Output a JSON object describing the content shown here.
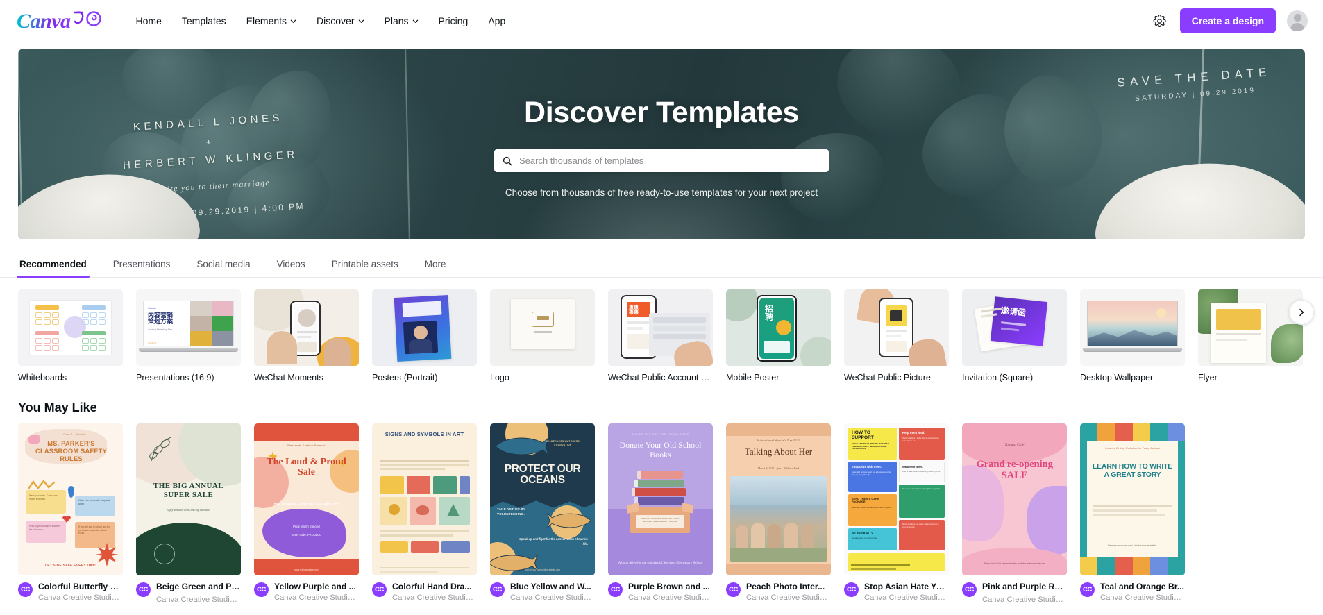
{
  "header": {
    "logo_text": "Canva",
    "nav": [
      {
        "label": "Home",
        "caret": false
      },
      {
        "label": "Templates",
        "caret": false
      },
      {
        "label": "Elements",
        "caret": true
      },
      {
        "label": "Discover",
        "caret": true
      },
      {
        "label": "Plans",
        "caret": true
      },
      {
        "label": "Pricing",
        "caret": false
      },
      {
        "label": "App",
        "caret": false
      }
    ],
    "settings_icon": "gear-icon",
    "cta_label": "Create a design",
    "accent_color": "#8b3dff"
  },
  "hero": {
    "title": "Discover Templates",
    "subtitle": "Choose from thousands of free ready-to-use templates for your next project",
    "search_placeholder": "Search thousands of templates",
    "search_value": "",
    "banner_art": {
      "name_1": "KENDALL L JONES",
      "plus": "+",
      "name_2": "HERBERT W KLINGER",
      "script_line": "invite you to their marriage",
      "date_line": "SATURDAY | 09.29.2019 | 4:00 PM",
      "save_the_date": "SAVE THE DATE",
      "save_the_date_sub": "SATURDAY | 09.29.2019"
    }
  },
  "tabs": [
    {
      "label": "Recommended",
      "active": true
    },
    {
      "label": "Presentations",
      "active": false
    },
    {
      "label": "Social media",
      "active": false
    },
    {
      "label": "Videos",
      "active": false
    },
    {
      "label": "Printable assets",
      "active": false
    },
    {
      "label": "More",
      "active": false
    }
  ],
  "categories": {
    "next_icon": "chevron-right-icon",
    "items": [
      {
        "label": "Whiteboards"
      },
      {
        "label": "Presentations (16:9)"
      },
      {
        "label": "WeChat Moments"
      },
      {
        "label": "Posters (Portrait)"
      },
      {
        "label": "Logo"
      },
      {
        "label": "WeChat Public Account Co..."
      },
      {
        "label": "Mobile Poster"
      },
      {
        "label": "WeChat Public Picture"
      },
      {
        "label": "Invitation (Square)"
      },
      {
        "label": "Desktop Wallpaper"
      },
      {
        "label": "Flyer"
      }
    ]
  },
  "you_may_like": {
    "heading": "You May Like",
    "avatar_initials": "CC",
    "items": [
      {
        "title": "Colorful Butterfly Or...",
        "author": "Canva Creative Studio | ...",
        "art": {
          "kind": "classroom",
          "eyebrow": "Class 1 - Butterfly",
          "headline": "MS. PARKER'S CLASSROOM SAFETY RULES",
          "footer": "LET'S BE SAFE EVERY DAY!"
        }
      },
      {
        "title": "Beige Green and Pink ...",
        "author": "Canva Creative Studio | 可...",
        "art": {
          "kind": "bigsale",
          "headline": "THE BIG ANNUAL SUPER SALE",
          "sub": "Enjoy fantastic deals and big discounts"
        }
      },
      {
        "title": "Yellow Purple and ...",
        "author": "Canva Creative Studio ...",
        "art": {
          "kind": "loudsale",
          "eyebrow": "Weekends Fashion Summer",
          "headline": "The Loud & Proud Sale",
          "line1": "ALL ORDERS OVER $50 GET 30% OFF",
          "line2": "Pride Month Special!",
          "line3": "Enter code: PROUD30"
        }
      },
      {
        "title": "Colorful Hand Dra...",
        "author": "Canva Creative Studio ...",
        "art": {
          "kind": "signsart",
          "headline": "SIGNS AND SYMBOLS IN ART"
        }
      },
      {
        "title": "Blue Yellow and W...",
        "author": "Canva Creative Studio ...",
        "art": {
          "kind": "oceans",
          "eyebrow": "WILDERNESS WATCHERS FOUNDATION",
          "headline": "PROTECT OUR OCEANS",
          "line1": "TAKE ACTION BY VOLUNTEERING.",
          "line2": "Speak up and fight for the conservation of marine life."
        }
      },
      {
        "title": "Purple Brown and ...",
        "author": "Canva Creative Studio ...",
        "art": {
          "kind": "books",
          "eyebrow": "SHARE THE GIFT OF KNOWLEDGE",
          "headline": "Donate Your Old School Books",
          "box": "DROP OFF YOUR NEW AND GENTLY-USED BOOKS AT THE COMMUNITY CENTER",
          "footer": "A book drive for the scholars of Sterriton Elementary School"
        }
      },
      {
        "title": "Peach Photo Inter...",
        "author": "Canva Creative Studio ...",
        "art": {
          "kind": "talking",
          "eyebrow": "International Women's Day 2021",
          "headline": "Talking About Her",
          "sub": "March 8, 2021 | 4pm | Wildrose Park"
        }
      },
      {
        "title": "Stop Asian Hate Yell...",
        "author": "Canva Creative Studio | ...",
        "art": {
          "kind": "support",
          "headline": "HOW TO SUPPORT",
          "sub": "ASIAN AMERICAN, PACIFIC ISLANDER FRIENDS, FAMILY, NEIGHBORS AND COLLEAGUES",
          "t1": "Help them heal.",
          "t2": "Walk with them.",
          "t3": "Empathize with them.",
          "t4": "SEND THEM A CARE PACKAGE",
          "t5": "BE THEIR ALLY."
        }
      },
      {
        "title": "Pink and Purple Retail ...",
        "author": "Canva Creative Studio | 可...",
        "art": {
          "kind": "reopening",
          "eyebrow": "Tomato Cafe",
          "headline": "Grand re-opening SALE",
          "footer": "Terms and full list of merchandise available at tomatocafe.com"
        }
      },
      {
        "title": "Teal and Orange Br...",
        "author": "Canva Creative Studio ...",
        "art": {
          "kind": "story",
          "eyebrow": "Creative Writing Workshop for Young Authors",
          "headline": "LEARN HOW TO WRITE A GREAT STORY",
          "footer": "Reserve your seat now! Limited slots available."
        }
      }
    ]
  }
}
